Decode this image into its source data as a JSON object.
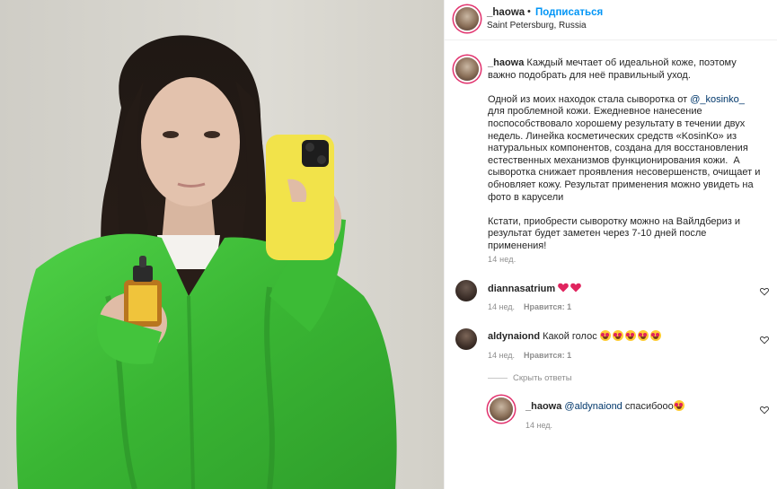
{
  "post": {
    "author": "_haowa",
    "dot": "•",
    "follow_label": "Подписаться",
    "location": "Saint Petersburg, Russia"
  },
  "caption": {
    "username": "_haowa",
    "text_1": " Каждый мечтает об идеальной коже, поэтому\nважно подобрать для неё правильный уход.\n\nОдной из моих находок стала сыворотка от ",
    "mention": "@_kosinko_",
    "text_2": "\nдля проблемной кожи. Ежедневное нанесение\nпоспособствовало хорошему результату в течении двух\nнедель. Линейка косметических средств «KosinKo» из\nнатуральных компонентов, создана для восстановления\nестественных механизмов функционирования кожи.  А\nсыворотка снижает проявления несовершенств, очищает и\nобновляет кожу. Результат применения можно увидеть на\nфото в карусели\n\nКстати, приобрести сыворотку можно на Вайлдбериз и\nрезультат будет заметен через 7-10 дней после\nприменения!",
    "time": "14 нед."
  },
  "comments": [
    {
      "username": "diannasatrium",
      "text": "",
      "emoji": [
        "red-heart",
        "red-heart"
      ],
      "time": "14 нед.",
      "likes": "Нравится: 1"
    },
    {
      "username": "aldynaiond",
      "text": " Какой голос ",
      "emoji": [
        "heart-eyes",
        "heart-eyes",
        "heart-eyes",
        "heart-eyes",
        "heart-eyes"
      ],
      "time": "14 нед.",
      "likes": "Нравится: 1"
    }
  ],
  "hide_replies_label": "Скрыть ответы",
  "reply": {
    "username": "_haowa",
    "mention": "@aldynaiond",
    "text": " спасибооо",
    "emoji": [
      "heart-eyes"
    ],
    "time": "14 нед."
  },
  "colors": {
    "accent": "#0095f6",
    "mention": "#00376b",
    "muted": "#8e8e8e",
    "jacket": "#3fbf3a",
    "phone": "#f2e34a"
  }
}
